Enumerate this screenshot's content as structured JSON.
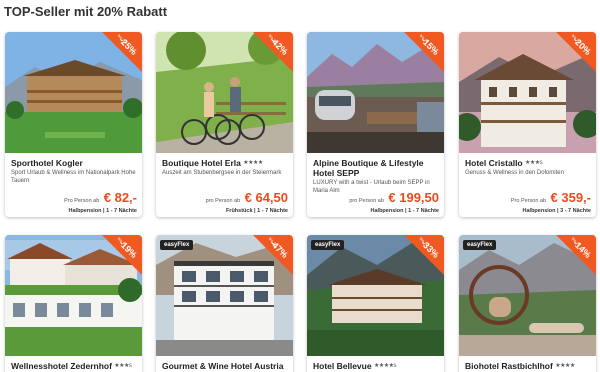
{
  "page": {
    "title": "TOP-Seller mit 20% Rabatt"
  },
  "colors": {
    "accent": "#e84c1d",
    "ribbon": "#f05a22",
    "badge": "#222222"
  },
  "cards": [
    {
      "name": "Sporthotel Kogler",
      "stars": "",
      "subtitle": "Sport Urlaub & Wellness im Nationalpark Hohe Tauern",
      "discount": "-25%",
      "ribbon_small": "bis zu",
      "price_from": "Pro Person ab",
      "price": "€ 82,-",
      "board": "Halbpension | 1 - 7 Nächte",
      "badge": ""
    },
    {
      "name": "Boutique Hotel Erla",
      "stars": "★★★★",
      "subtitle": "Auszeit am Stubenbergsee in der Steiermark",
      "discount": "-42%",
      "ribbon_small": "bis zu",
      "price_from": "pro Person ab",
      "price": "€ 64,50",
      "board": "Frühstück | 1 - 7 Nächte",
      "badge": ""
    },
    {
      "name": "Alpine Boutique & Lifestyle Hotel SEPP",
      "stars": "",
      "subtitle": "LUXURY with a twist - Urlaub beim SEPP in Maria Alm",
      "discount": "-15%",
      "ribbon_small": "bis zu",
      "price_from": "pro Person ab",
      "price": "€ 199,50",
      "board": "Halbpension | 1 - 7 Nächte",
      "badge": ""
    },
    {
      "name": "Hotel Cristallo",
      "stars": "★★★s",
      "subtitle": "Genuss & Wellness in den Dolomiten",
      "discount": "-20%",
      "ribbon_small": "bis zu",
      "price_from": "Pro Person ab",
      "price": "€ 359,-",
      "board": "Halbpension | 3 - 7 Nächte",
      "badge": ""
    },
    {
      "name": "Wellnesshotel Zedernhof",
      "stars": "★★★s",
      "subtitle": "",
      "discount": "-19%",
      "ribbon_small": "bis zu",
      "price_from": "",
      "price": "",
      "board": "",
      "badge": ""
    },
    {
      "name": "Gourmet & Wine Hotel Austria",
      "stars": "",
      "subtitle": "",
      "discount": "-47%",
      "ribbon_small": "bis zu",
      "price_from": "",
      "price": "",
      "board": "",
      "badge": "easyFlex"
    },
    {
      "name": "Hotel Bellevue",
      "stars": "★★★★s",
      "subtitle": "",
      "discount": "-33%",
      "ribbon_small": "bis zu",
      "price_from": "",
      "price": "",
      "board": "",
      "badge": "easyFlex"
    },
    {
      "name": "Biohotel Rastbichlhof",
      "stars": "★★★★",
      "subtitle": "",
      "discount": "-14%",
      "ribbon_small": "bis zu",
      "price_from": "",
      "price": "",
      "board": "",
      "badge": "easyFlex"
    }
  ]
}
